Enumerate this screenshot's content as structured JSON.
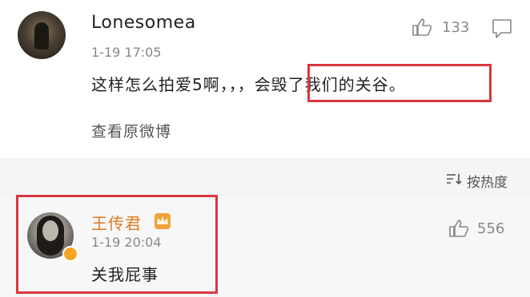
{
  "top_comment": {
    "username": "Lonesomea",
    "time": "1-19 17:05",
    "likes": "133",
    "text": "这样怎么拍爱5啊，，，会毁了我们的关谷。",
    "view_original": "查看原微博"
  },
  "sort": {
    "label": "按热度"
  },
  "reply_comment": {
    "username": "王传君",
    "time": "1-19 20:04",
    "likes": "556",
    "text": "关我屁事"
  },
  "colors": {
    "highlight": "#d9363e",
    "vip_name": "#e07a1f",
    "muted": "#888888"
  },
  "icons": [
    "thumbs-up-icon",
    "reply-icon",
    "sort-icon",
    "vip-crown-icon",
    "verified-icon"
  ]
}
